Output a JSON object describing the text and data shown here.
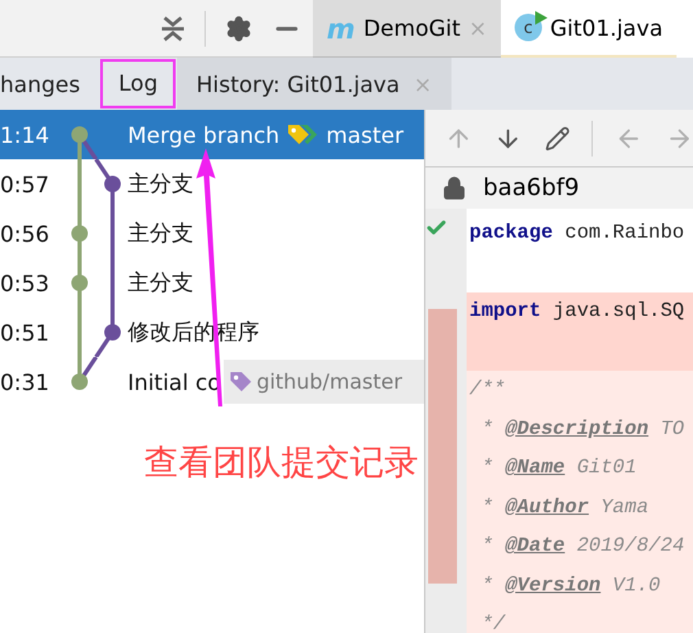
{
  "editor_tabs": [
    {
      "logo": "m",
      "label": "DemoGit",
      "close": "×",
      "selected": false
    },
    {
      "logo": "c",
      "label": "Git01.java",
      "selected": true
    }
  ],
  "panel_tabs": [
    {
      "label": "hanges",
      "selected": false,
      "annotated": false,
      "kind": "plain"
    },
    {
      "label": "Log",
      "selected": true,
      "annotated": true,
      "kind": "plain"
    },
    {
      "label": "History: Git01.java",
      "selected": false,
      "annotated": false,
      "kind": "closable",
      "close": "×"
    }
  ],
  "commits": [
    {
      "time": "1:14",
      "subject": "Merge branch",
      "side_branch": false,
      "selected": true,
      "tag": {
        "label": "master",
        "kind": "head"
      }
    },
    {
      "time": "0:57",
      "subject": "主分支",
      "side_branch": true,
      "selected": false
    },
    {
      "time": "0:56",
      "subject": "主分支",
      "side_branch": false,
      "selected": false
    },
    {
      "time": "0:53",
      "subject": "主分支",
      "side_branch": false,
      "selected": false
    },
    {
      "time": "0:51",
      "subject": "修改后的程序",
      "side_branch": true,
      "selected": false
    },
    {
      "time": "0:31",
      "subject": "Initial co",
      "side_branch": false,
      "selected": false,
      "tag": {
        "label": "github/master",
        "kind": "remote"
      }
    }
  ],
  "diff": {
    "hash": "baa6bf9",
    "blocks": [
      {
        "kind": "unchanged",
        "lines": [
          {
            "text": "**package** com.Rainbo",
            "kind": "code",
            "checked": true
          }
        ]
      },
      {
        "kind": "changed",
        "lines": [
          {
            "text": "**import** java.sql.SQ",
            "kind": "code",
            "checked": false
          }
        ]
      },
      {
        "kind": "modified",
        "lines": [
          {
            "text": "/**",
            "kind": "comment",
            "checked": false
          },
          {
            "text": " * **@Description** TO",
            "kind": "comment",
            "checked": false
          },
          {
            "text": " * **@Name** Git01",
            "kind": "comment",
            "checked": false
          },
          {
            "text": " * **@Author** Yama",
            "kind": "comment",
            "checked": false
          },
          {
            "text": " * **@Date** 2019/8/24",
            "kind": "comment",
            "checked": false
          },
          {
            "text": " * **@Version** V1.0",
            "kind": "comment",
            "checked": false
          },
          {
            "text": " */",
            "kind": "comment",
            "checked": false
          }
        ]
      }
    ]
  },
  "annotation": {
    "text": "查看团队提交记录"
  }
}
